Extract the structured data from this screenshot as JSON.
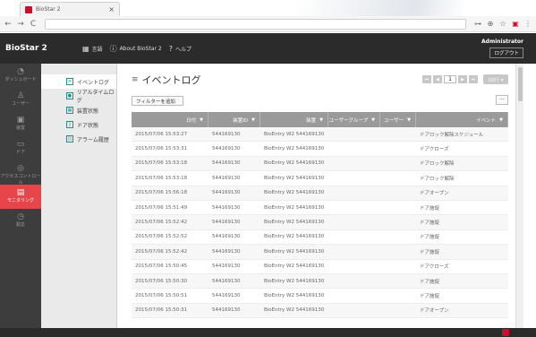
{
  "browser": {
    "tab_title": "BioStar 2",
    "tab_close": "×",
    "nav": {
      "back": "←",
      "forward": "→",
      "reload": "C"
    },
    "icons": {
      "key": "⊶",
      "zoom": "⊕",
      "star": "☆",
      "ext": "▣",
      "menu": "⋮"
    }
  },
  "header": {
    "brand": "BioStar 2",
    "links": [
      {
        "icon": "▦",
        "label": "言語"
      },
      {
        "icon": "ⓘ",
        "label": "About BioStar 2"
      },
      {
        "icon": "?",
        "label": "ヘルプ"
      }
    ],
    "user": {
      "name": "Administrator",
      "logout": "ログアウト"
    }
  },
  "left_nav": [
    {
      "icon": "◔",
      "label": "ダッシュボード"
    },
    {
      "icon": "♙",
      "label": "ユーザー"
    },
    {
      "icon": "▣",
      "label": "装置"
    },
    {
      "icon": "▭",
      "label": "ドア"
    },
    {
      "icon": "◎",
      "label": "アクセスコントロール"
    },
    {
      "icon": "▤",
      "label": "モニタリング"
    },
    {
      "icon": "◷",
      "label": "勤怠"
    }
  ],
  "sub_nav": [
    {
      "icon": "≡",
      "label": "イベントログ"
    },
    {
      "icon": "●",
      "label": "リアルタイムログ"
    },
    {
      "icon": "▦",
      "label": "装置状態"
    },
    {
      "icon": "▯",
      "label": "ドア状態"
    },
    {
      "icon": "◫",
      "label": "アラーム履歴"
    }
  ],
  "content": {
    "title_icon": "≡",
    "title": "イベントログ",
    "filter_label": "フィルターを追加",
    "more_label": "···",
    "pager": {
      "first": "⏮",
      "prev": "◀",
      "page": "1",
      "next": "▶",
      "last": "⏭",
      "per_page": "50行 ▾"
    },
    "columns": [
      "日付",
      "装置ID",
      "装置",
      "ユーザーグループ",
      "ユーザー",
      "イベント"
    ],
    "filter_glyph": "▼",
    "rows": [
      [
        "2015/07/06 15:53:27",
        "544169130",
        "BioEntry W2 544169130",
        "ドアロック解除スケジュール"
      ],
      [
        "2015/07/06 15:53:31",
        "544169130",
        "BioEntry W2 544169130",
        "ドアクローズ"
      ],
      [
        "2015/07/06 15:53:18",
        "544169130",
        "BioEntry W2 544169130",
        "ドアロック解除"
      ],
      [
        "2015/07/06 15:53:18",
        "544169130",
        "BioEntry W2 544169130",
        "ドアロック解除"
      ],
      [
        "2015/07/06 15:56:18",
        "544169130",
        "BioEntry W2 544169130",
        "ドアオープン"
      ],
      [
        "2015/07/06 15:51:49",
        "544169130",
        "BioEntry W2 544169130",
        "ドア施錠"
      ],
      [
        "2015/07/06 15:52:42",
        "544169130",
        "BioEntry W2 544169130",
        "ドア施錠"
      ],
      [
        "2015/07/06 15:52:52",
        "544169130",
        "BioEntry W2 544169130",
        "ドア施錠"
      ],
      [
        "2015/07/06 15:52:42",
        "544169130",
        "BioEntry W2 544169130",
        "ドア施錠"
      ],
      [
        "2015/07/06 15:50:45",
        "544169130",
        "BioEntry W2 544169130",
        "ドアクローズ"
      ],
      [
        "2015/07/06 15:50:30",
        "544169130",
        "BioEntry W2 544169130",
        "ドア施錠"
      ],
      [
        "2015/07/06 15:50:51",
        "544169130",
        "BioEntry W2 544169130",
        "ドア施錠"
      ],
      [
        "2015/07/06 15:50:31",
        "544169130",
        "BioEntry W2 544169130",
        "ドアオープン"
      ]
    ]
  },
  "colors": {
    "header_bg": "#2b2b2b",
    "active_nav": "#e8454a",
    "accent": "#2a8c8c",
    "brand_red": "#c8102e"
  }
}
